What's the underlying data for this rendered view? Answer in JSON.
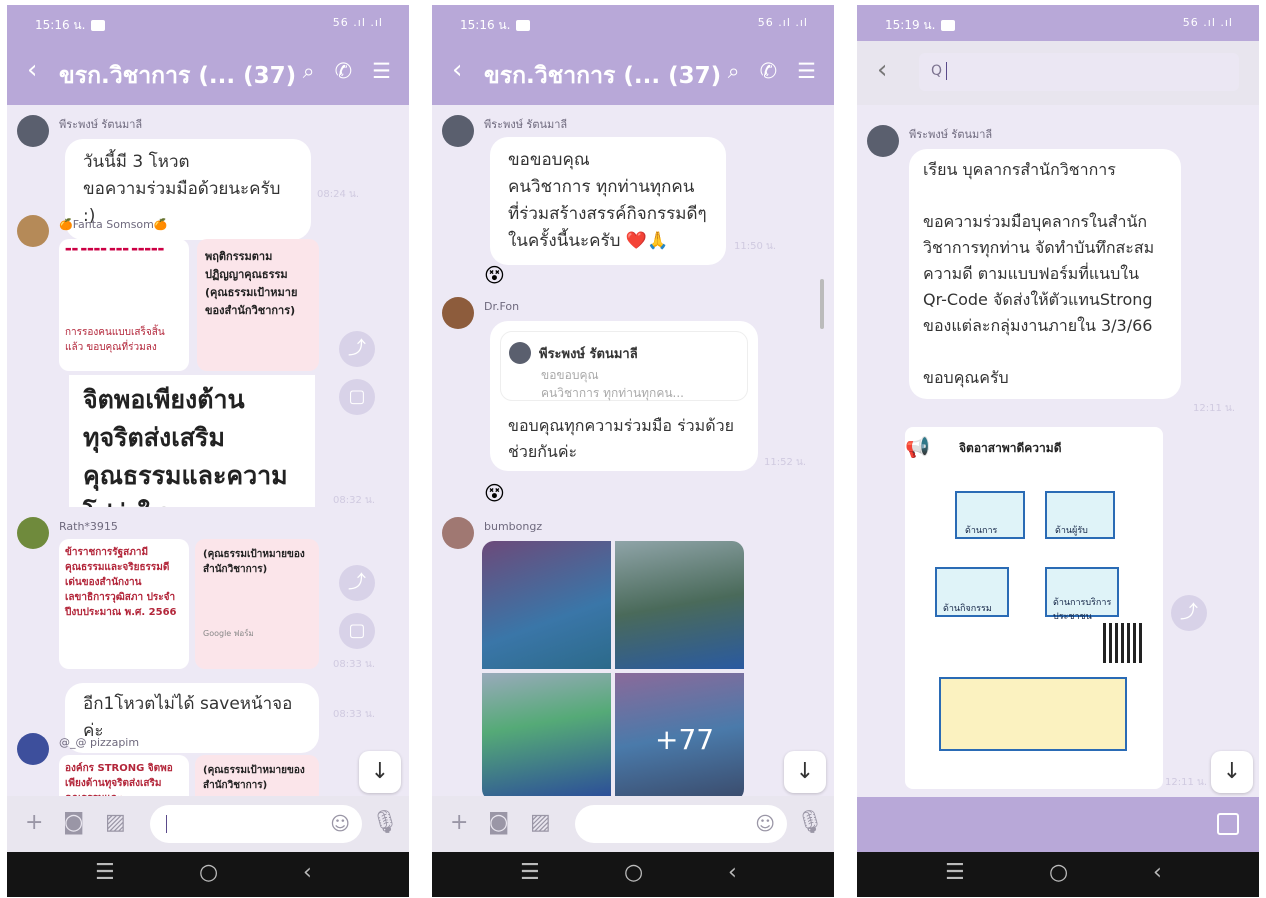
{
  "status": {
    "time1": "15:16 น.",
    "time2": "15:16 น.",
    "time3": "15:19 น.",
    "signal": "56 .ıl .ıl"
  },
  "header": {
    "title": "ขรก.วิชาการ (... (37)"
  },
  "search": {
    "placeholder": "Q"
  },
  "colors": {
    "header": "#b8a8d8",
    "background": "#ede9f5",
    "bubble": "#ffffff"
  },
  "phone1": {
    "messages": [
      {
        "sender": "พีระพงษ์ รัตนมาลี",
        "text": "วันนี้มี 3 โหวต\nขอความร่วมมือด้วยนะครับ :)",
        "time": "08:24 น."
      },
      {
        "sender": "🍊Fanta Somsom🍊",
        "card_left": "การรองคนแบบเสร็จสิ้น แล้ว ขอบคุณที่ร่วมลง",
        "card_right": "พฤติกรรมตามปฏิญญาคุณธรรม (คุณธรรมเป้าหมายของสำนักวิชาการ)",
        "big": "จิตพอเพียงต้านทุจริตส่งเสริมคุณธรรมและความโปร่งใสของ",
        "time": "08:32 น."
      },
      {
        "sender": "Rath*3915",
        "card_left": "ข้าราชการรัฐสภามีคุณธรรมและจริยธรรมดีเด่นของสำนักงานเลขาธิการวุฒิสภา ประจำปีงบประมาณ พ.ศ. 2566",
        "card_right": "(คุณธรรมเป้าหมายของสำนักวิชาการ)",
        "form": "Google ฟอร์ม",
        "time": "08:33 น."
      },
      {
        "text": "อีก1โหวตไม่ได้ saveหน้าจอค่ะ",
        "time": "08:33 น."
      },
      {
        "sender": "@_@ pizzapim",
        "card_left": "องค์กร STRONG จิตพอเพียงต้านทุจริตส่งเสริมคุณธรรมและ",
        "card_right": "(คุณธรรมเป้าหมายของสำนักวิชาการ)"
      }
    ]
  },
  "phone2": {
    "messages": [
      {
        "sender": "พีระพงษ์ รัตนมาลี",
        "text": "ขอขอบคุณ\nคนวิชาการ ทุกท่านทุกคน\nที่ร่วมสร้างสรรค์กิจกรรมดีๆ\nในครั้งนี้นะครับ ❤️🙏",
        "time": "11:50 น."
      },
      {
        "emoji": "😵"
      },
      {
        "sender": "Dr.Fon",
        "quote_name": "พีระพงษ์ รัตนมาลี",
        "quote_line1": "ขอขอบคุณ",
        "quote_line2": "คนวิชาการ ทุกท่านทุกคน...",
        "text": "ขอบคุณทุกความร่วมมือ ร่วมด้วยช่วยกันค่ะ",
        "time": "11:52 น."
      },
      {
        "emoji": "😵"
      },
      {
        "sender": "bumbongz",
        "more": "+77"
      }
    ]
  },
  "phone3": {
    "messages": [
      {
        "sender": "พีระพงษ์ รัตนมาลี",
        "text": "เรียน บุคลากรสำนักวิชาการ\n\n ขอความร่วมมือบุคลากรในสำนักวิชาการทุกท่าน จัดทำบันทึกสะสมความดี ตามแบบฟอร์มที่แนบใน Qr-Code จัดส่งให้ตัวแทนStrong ของแต่ละกลุ่มงานภายใน 3/3/66\n\nขอบคุณครับ",
        "time": "12:11 น."
      },
      {
        "poster_title": "จิตอาสาพาดีความดี",
        "box1": "ด้านการ",
        "box2": "ด้านผู้รับ",
        "box3": "ด้านกิจกรรม",
        "box4": "ด้านการบริการประชาชน",
        "time": "12:11 น."
      }
    ]
  }
}
